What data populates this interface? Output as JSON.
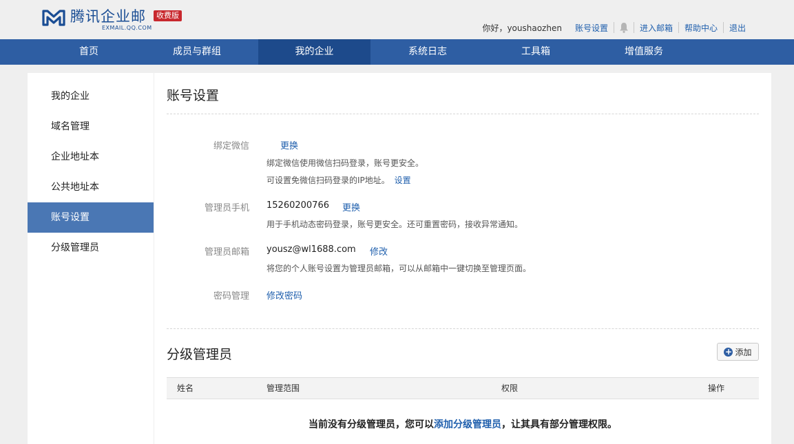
{
  "header": {
    "logo_text": "腾讯企业邮",
    "logo_sub": "EXMAIL.QQ.COM",
    "badge": "收费版",
    "greeting": "你好，youshaozhen",
    "links": {
      "account_settings": "账号设置",
      "enter_mailbox": "进入邮箱",
      "help_center": "帮助中心",
      "logout": "退出"
    }
  },
  "nav": {
    "items": [
      "首页",
      "成员与群组",
      "我的企业",
      "系统日志",
      "工具箱",
      "增值服务"
    ],
    "active": "我的企业"
  },
  "sidebar": {
    "items": [
      "我的企业",
      "域名管理",
      "企业地址本",
      "公共地址本",
      "账号设置",
      "分级管理员"
    ],
    "active": "账号设置"
  },
  "account": {
    "title": "账号设置",
    "wechat": {
      "label": "绑定微信",
      "action": "更换",
      "desc1": "绑定微信使用微信扫码登录，账号更安全。",
      "desc2": "可设置免微信扫码登录的IP地址。",
      "desc2_link": "设置"
    },
    "phone": {
      "label": "管理员手机",
      "value": "15260200766",
      "action": "更换",
      "desc": "用于手机动态密码登录，账号更安全。还可重置密码，接收异常通知。"
    },
    "email": {
      "label": "管理员邮箱",
      "value": "yousz@wl1688.com",
      "action": "修改",
      "desc": "将您的个人账号设置为管理员邮箱，可以从邮箱中一键切换至管理页面。"
    },
    "password": {
      "label": "密码管理",
      "action": "修改密码"
    }
  },
  "sub_admin": {
    "title": "分级管理员",
    "add_label": "添加",
    "columns": [
      "姓名",
      "管理范围",
      "权限",
      "操作"
    ],
    "empty_prefix": "当前没有分级管理员，您可以",
    "empty_link": "添加分级管理员",
    "empty_suffix": "，让其具有部分管理权限。"
  },
  "colors": {
    "nav_bg": "#2e5ea3",
    "nav_active": "#1d4a8b",
    "sidebar_active": "#4a77b4",
    "link": "#1f5fad",
    "badge": "#c8282e"
  },
  "icons": {
    "logo": "tencent-exmail-logo-icon",
    "bell": "bell-icon",
    "add": "plus-circle-icon"
  }
}
